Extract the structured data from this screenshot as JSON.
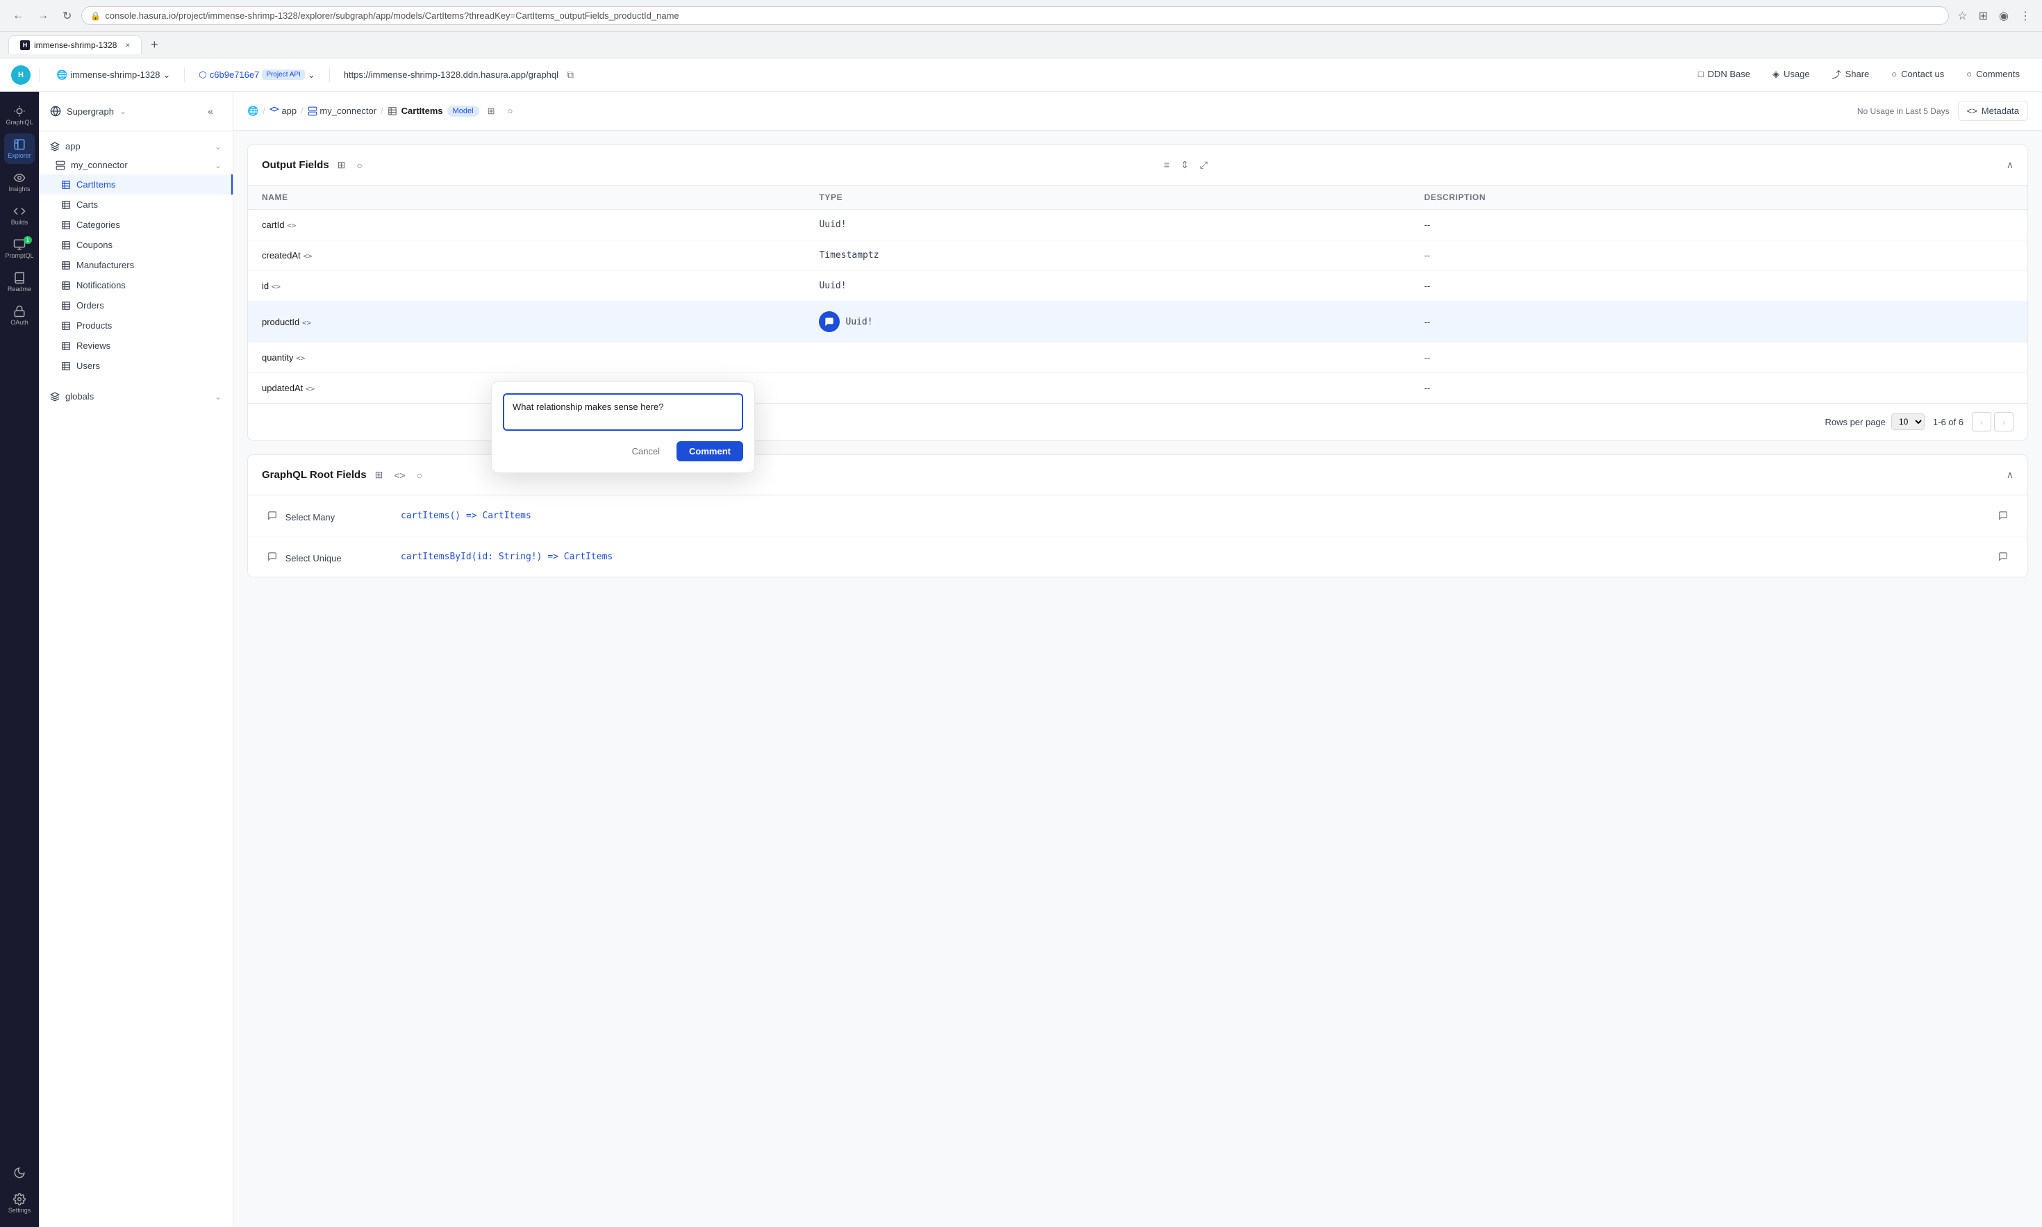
{
  "browser": {
    "back_btn": "‹",
    "forward_btn": "›",
    "refresh_btn": "↻",
    "url": "console.hasura.io/project/immense-shrimp-1328/explorer/subgraph/app/models/CartItems?threadKey=CartItems_outputFields_productId_name",
    "star_icon": "★",
    "extensions_icon": "⊞",
    "profile_icon": "◉",
    "menu_icon": "⋮"
  },
  "tabs": [
    {
      "label": "immense-shrimp-1328",
      "active": true,
      "favicon": "H"
    }
  ],
  "header_nav": {
    "project_name": "immense-shrimp-1328",
    "project_chevron": "⌄",
    "commit_hash": "c6b9e716e7",
    "project_api_badge": "Project API",
    "graphql_url": "https://immense-shrimp-1328.ddn.hasura.app/graphql",
    "copy_icon": "⧉",
    "nav_items": [
      {
        "label": "DDN Base",
        "icon": "□"
      },
      {
        "label": "Usage",
        "icon": "◈"
      },
      {
        "label": "Share",
        "icon": "⤴"
      },
      {
        "label": "Contact us",
        "icon": "○"
      },
      {
        "label": "Comments",
        "icon": "○"
      }
    ]
  },
  "icon_rail": {
    "items": [
      {
        "label": "GraphiQL",
        "icon": "graphql"
      },
      {
        "label": "Explorer",
        "icon": "explorer",
        "active": true
      },
      {
        "label": "Insights",
        "icon": "insights"
      },
      {
        "label": "Builds",
        "icon": "builds"
      },
      {
        "label": "PromptQL",
        "icon": "promptql",
        "badge": "1"
      },
      {
        "label": "Readme",
        "icon": "readme"
      },
      {
        "label": "OAuth",
        "icon": "oauth"
      }
    ],
    "bottom_items": [
      {
        "label": "Dark mode",
        "icon": "moon"
      },
      {
        "label": "Settings",
        "icon": "gear"
      }
    ]
  },
  "sidebar": {
    "supergraph_label": "Supergraph",
    "supergraph_chevron": "⌄",
    "app_label": "app",
    "app_chevron": "⌄",
    "connector_label": "my_connector",
    "connector_chevron": "⌄",
    "models": [
      {
        "label": "CartItems",
        "active": true
      },
      {
        "label": "Carts"
      },
      {
        "label": "Categories"
      },
      {
        "label": "Coupons"
      },
      {
        "label": "Manufacturers"
      },
      {
        "label": "Notifications"
      },
      {
        "label": "Orders"
      },
      {
        "label": "Products"
      },
      {
        "label": "Reviews"
      },
      {
        "label": "Users"
      }
    ],
    "globals_label": "globals",
    "globals_chevron": "⌄",
    "collapse_icon": "«"
  },
  "topbar": {
    "breadcrumb": [
      {
        "label": "🌐",
        "type": "icon"
      },
      {
        "label": "/",
        "type": "sep"
      },
      {
        "label": "app",
        "type": "link"
      },
      {
        "label": "/",
        "type": "sep"
      },
      {
        "label": "my_connector",
        "type": "link"
      },
      {
        "label": "/",
        "type": "sep"
      },
      {
        "label": "CartItems",
        "type": "current"
      }
    ],
    "model_badge": "Model",
    "table_icon": "⊞",
    "comment_icon": "○",
    "no_usage": "No Usage in Last 5 Days",
    "code_icon": "<>",
    "metadata_label": "Metadata"
  },
  "output_fields": {
    "section_title": "Output Fields",
    "grid_icon": "⊞",
    "comment_icon": "○",
    "table_view_icon": "≡",
    "expand_icon": "⇕",
    "fullscreen_icon": "⤢",
    "collapse_icon": "∧",
    "columns": [
      {
        "label": "Name"
      },
      {
        "label": "Type"
      },
      {
        "label": "Description"
      }
    ],
    "rows": [
      {
        "name": "cartId",
        "code": "<>",
        "type": "Uuid!",
        "description": "--",
        "comment_active": false
      },
      {
        "name": "createdAt",
        "code": "<>",
        "type": "Timestamptz",
        "description": "--",
        "comment_active": false
      },
      {
        "name": "id",
        "code": "<>",
        "type": "Uuid!",
        "description": "--",
        "comment_active": false
      },
      {
        "name": "productId",
        "code": "<>",
        "type": "Uuid!",
        "description": "--",
        "comment_active": true
      },
      {
        "name": "quantity",
        "code": "<>",
        "type": "",
        "description": "--",
        "comment_active": false
      },
      {
        "name": "updatedAt",
        "code": "<>",
        "type": "",
        "description": "--",
        "comment_active": false
      }
    ],
    "rows_per_page_label": "Rows per page",
    "rows_per_page_value": "10",
    "page_info": "1-6 of 6",
    "prev_page": "‹",
    "next_page": "›"
  },
  "comment_popup": {
    "placeholder": "What relationship makes sense here?",
    "cancel_label": "Cancel",
    "submit_label": "Comment"
  },
  "graphql_root_fields": {
    "section_title": "GraphQL Root Fields",
    "grid_icon": "⊞",
    "code_icon": "<>",
    "comment_icon": "○",
    "collapse_icon": "∧",
    "rows": [
      {
        "label": "Select Many",
        "comment_icon": "○",
        "link": "cartItems() => CartItems",
        "link_icon": "○"
      },
      {
        "label": "Select Unique",
        "comment_icon": "○",
        "link": "cartItemsById(id: String!) => CartItems",
        "link_icon": "○"
      }
    ]
  }
}
